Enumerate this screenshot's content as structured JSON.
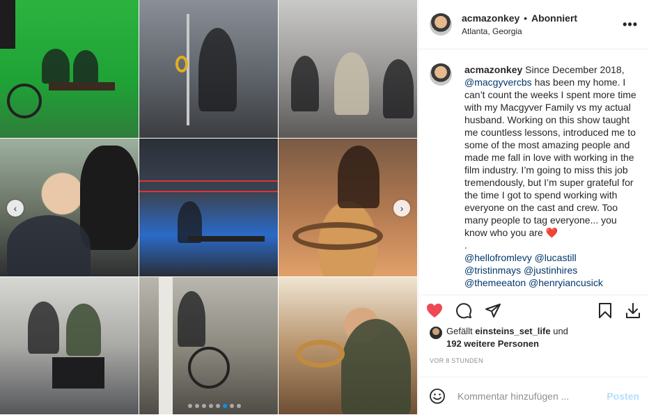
{
  "header": {
    "username": "acmazonkey",
    "separator": "•",
    "follow_status": "Abonniert",
    "location": "Atlanta, Georgia",
    "more_label": "•••"
  },
  "caption": {
    "username": "acmazonkey",
    "text_1": "Since December 2018,",
    "mention_1": "@macgyvercbs",
    "text_2": "has been my home. I can’t count the weeks I spent more time with my Macgyver Family vs my actual husband. Working on this show taught me countless lessons, introduced me to some of the most amazing people and made me fall in love with working in the film industry. I’m going to miss this job tremendously, but I’m super grateful for the time I got to spend working with everyone on the cast and crew. Too many people to tag everyone... you know who you are",
    "emoji": "❤️",
    "dot_line": ".",
    "tag_1": "@hellofromlevy",
    "tag_2": "@lucastill",
    "tag_3": "@tristinmays",
    "tag_4": "@justinhires",
    "tag_5": "@themeeaton",
    "tag_6": "@henryiancusick"
  },
  "likes": {
    "prefix": "Gefällt",
    "liker": "einsteins_set_life",
    "connector": "und",
    "others": "192 weitere Personen"
  },
  "timestamp": "VOR 8 STUNDEN",
  "comment": {
    "placeholder": "Kommentar hinzufügen ...",
    "post_label": "Posten"
  },
  "carousel": {
    "slide_count": 8,
    "active_index": 5
  },
  "colors": {
    "heart": "#ed4956",
    "link": "#00376b",
    "active_dot": "#0095f6",
    "post_disabled": "#b2dffc"
  }
}
